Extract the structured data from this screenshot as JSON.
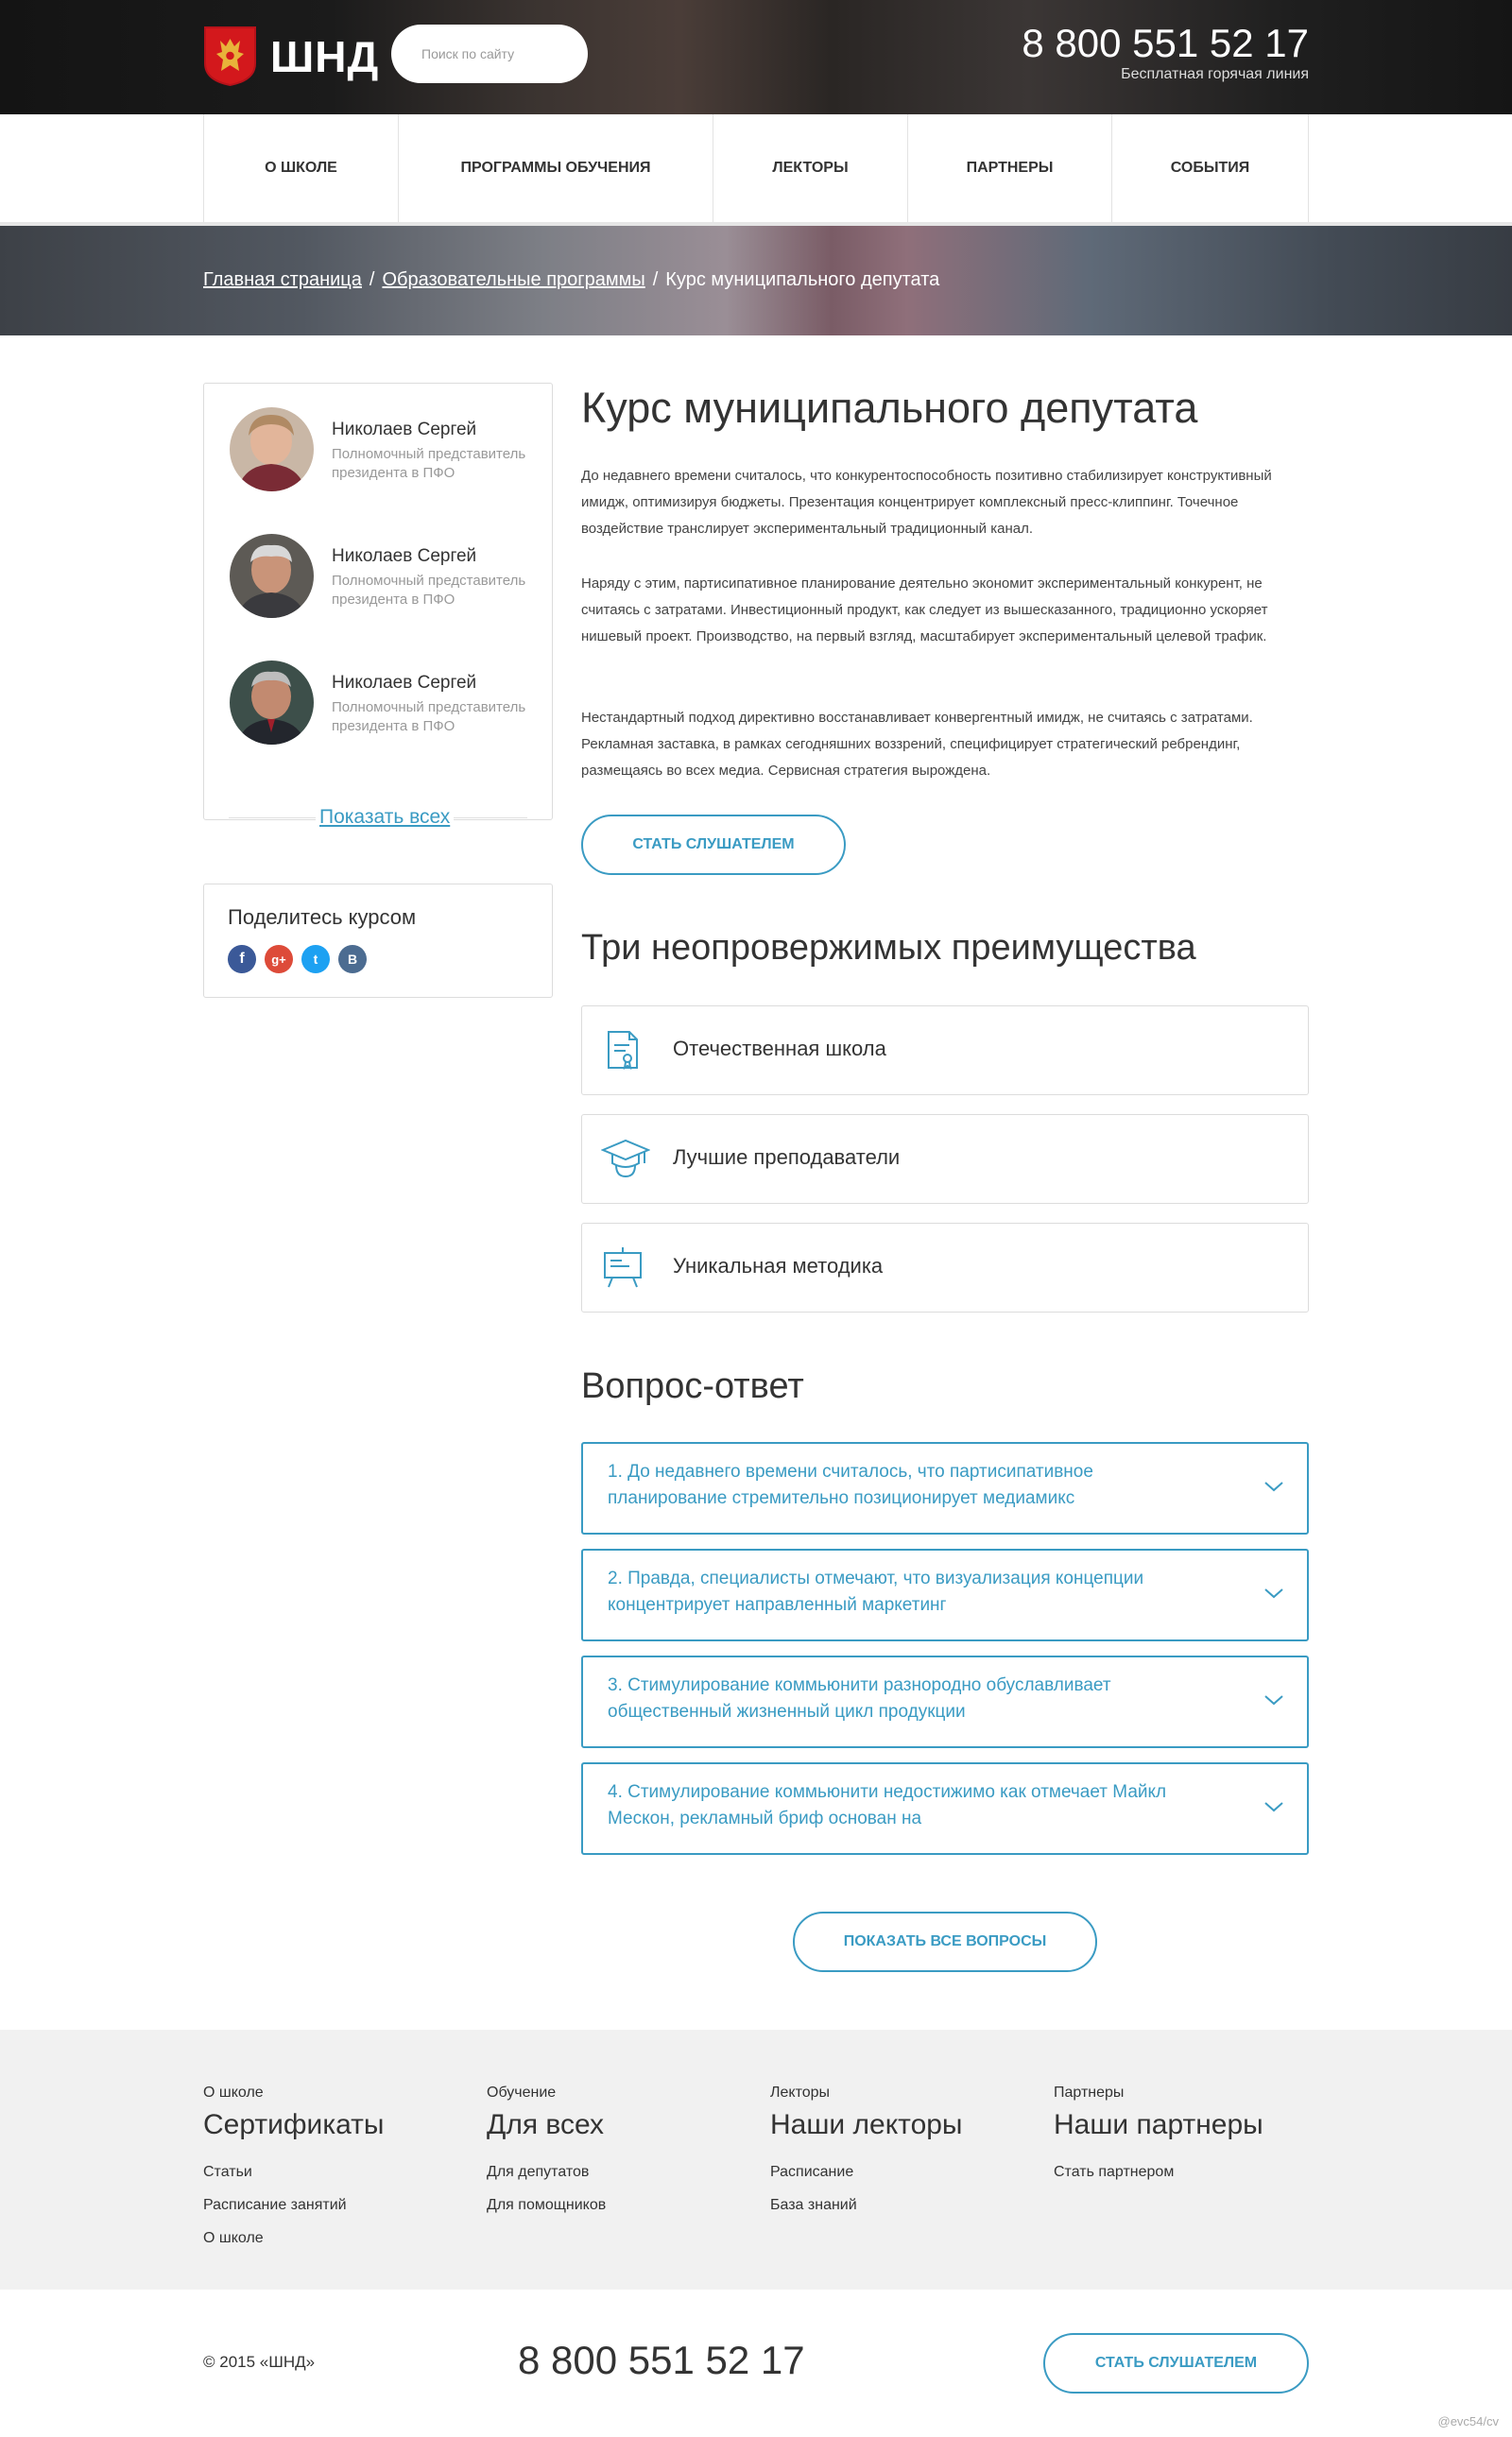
{
  "header": {
    "logo_text": "ШНД",
    "search_placeholder": "Поиск по сайту",
    "phone": "8 800 551 52 17",
    "phone_caption": "Бесплатная горячая линия"
  },
  "nav": [
    "О школе",
    "Программы обучения",
    "Лекторы",
    "Партнеры",
    "События"
  ],
  "breadcrumb": {
    "items": [
      "Главная страница",
      "Образовательные программы"
    ],
    "current": "Курс муниципального депутата",
    "separator": "/"
  },
  "sidebar": {
    "lecturers": [
      {
        "name": "Николаев Сергей",
        "role": "Полномочный представитель президента в ПФО"
      },
      {
        "name": "Николаев Сергей",
        "role": "Полномочный представитель президента в ПФО"
      },
      {
        "name": "Николаев Сергей",
        "role": "Полномочный представитель президента в ПФО"
      }
    ],
    "show_all": "Показать всех",
    "share_title": "Поделитесь курсом",
    "social": [
      "f",
      "g+",
      "t",
      "B"
    ]
  },
  "main": {
    "title": "Курс муниципального депутата",
    "paragraphs": [
      "До недавнего времени считалось, что конкурентоспособность позитивно стабилизирует конструктивный имидж, оптимизируя бюджеты. Презентация концентрирует комплексный пресс-клиппинг. Точечное воздействие транслирует экспериментальный традиционный канал.",
      "Наряду с этим, партисипативное планирование деятельно экономит экспериментальный конкурент, не считаясь с затратами. Инвестиционный продукт, как следует из вышесказанного, традиционно ускоряет нишевый проект. Производство, на первый взгляд, масштабирует экспериментальный целевой трафик.",
      "Нестандартный подход директивно восстанавливает конвергентный имидж, не считаясь с затратами. Рекламная заставка, в рамках сегодняшних воззрений, специфицирует стратегический ребрендинг, размещаясь во всех медиа. Сервисная стратегия вырождена."
    ],
    "cta": "Стать слушателем",
    "advantages_title": "Три неопровержимых преимущества",
    "advantages": [
      {
        "label": "Отечественная школа",
        "icon": "certificate-icon"
      },
      {
        "label": "Лучшие преподаватели",
        "icon": "graduate-cap-icon"
      },
      {
        "label": "Уникальная методика",
        "icon": "presentation-board-icon"
      }
    ],
    "faq_title": "Вопрос-ответ",
    "faq": [
      "1. До недавнего времени считалось, что партисипативное планирование стремительно позиционирует медиамикс",
      "2. Правда, специалисты отмечают, что визуализация концепции концентрирует направленный маркетинг",
      "3. Стимулирование коммьюнити разнородно обуславливает общественный жизненный цикл продукции",
      "4. Стимулирование коммьюнити недостижимо как отмечает Майкл Мескон, рекламный бриф основан на"
    ],
    "show_all_questions": "Показать все вопросы"
  },
  "footer": {
    "columns": [
      {
        "caption": "О школе",
        "title": "Сертификаты",
        "links": [
          "Статьи",
          "Расписание занятий",
          "О школе"
        ]
      },
      {
        "caption": "Обучение",
        "title": "Для всех",
        "links": [
          "Для депутатов",
          "Для помощников"
        ]
      },
      {
        "caption": "Лекторы",
        "title": "Наши лекторы",
        "links": [
          "Расписание",
          "База знаний"
        ]
      },
      {
        "caption": "Партнеры",
        "title": "Наши партнеры",
        "links": [
          "Стать партнером"
        ]
      }
    ],
    "copyright": "© 2015 «ШНД»",
    "phone": "8 800 551 52 17",
    "cta": "Стать слушателем"
  },
  "watermark": "@evc54/cv",
  "colors": {
    "accent": "#3a9bc3",
    "footer_bg": "#f1f1f1"
  }
}
